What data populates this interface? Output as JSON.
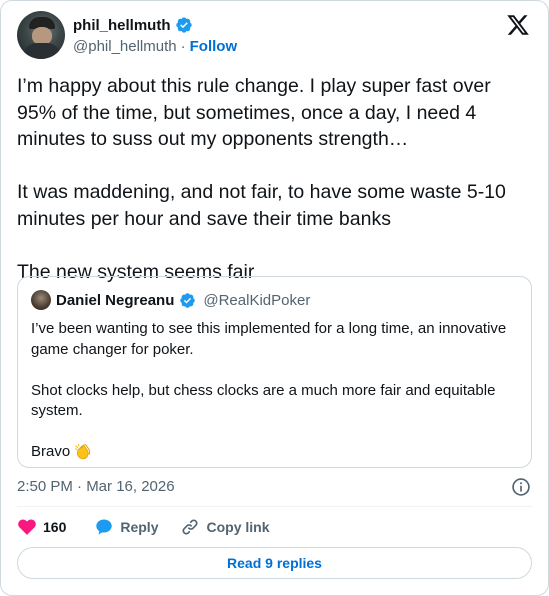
{
  "author": {
    "name": "phil_hellmuth",
    "handle": "@phil_hellmuth",
    "separator": "·",
    "follow_label": "Follow"
  },
  "tweet": {
    "text": "I’m happy about this rule change. I play super fast over 95% of the time, but sometimes, once a day, I need 4 minutes to suss out my opponents strength…\n\nIt was maddening, and not fair, to have some waste 5-10 minutes per hour and save their time banks\n\nThe new system seems fair"
  },
  "quote": {
    "name": "Daniel Negreanu",
    "handle": "@RealKidPoker",
    "text": "I’ve been wanting to see this implemented for a long time, an innovative game changer for poker.\n\nShot clocks help, but chess clocks are a much more fair and equitable system.\n\nBravo"
  },
  "meta": {
    "timestamp": "2:50 PM · Mar 16, 2026"
  },
  "actions": {
    "like_count": "160",
    "reply_label": "Reply",
    "copy_link_label": "Copy link"
  },
  "read_replies_label": "Read 9 replies",
  "colors": {
    "accent": "#006fd6",
    "verified": "#1d9bf0",
    "heart": "#f91880",
    "muted": "#536471",
    "border": "#cfd9de"
  },
  "icons": {
    "verified": "verified-badge-icon",
    "x_logo": "x-logo-icon",
    "info": "info-icon",
    "heart": "heart-icon",
    "reply": "speech-bubble-icon",
    "copy_link": "link-icon",
    "clap": "clapping-hands-emoji"
  }
}
